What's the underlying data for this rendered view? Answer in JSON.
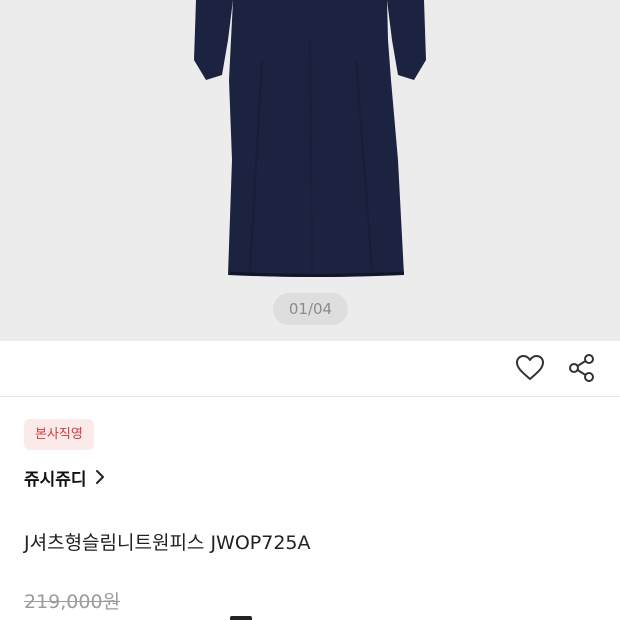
{
  "gallery": {
    "indicator": "01/04",
    "background_color": "#ececec",
    "garment_color": "#1b2340"
  },
  "actions": {
    "like_icon": "heart-outline-icon",
    "share_icon": "share-icon"
  },
  "product": {
    "badge": "본사직영",
    "brand": "쥬시쥬디",
    "brand_chevron": "chevron-right-icon",
    "name": "J셔츠형슬림니트원피스 JWOP725A",
    "original_price": "219,000원"
  },
  "colors": {
    "badge_bg": "#fbeaea",
    "badge_text": "#d43a3a",
    "strike_price": "#9b9b9b"
  }
}
